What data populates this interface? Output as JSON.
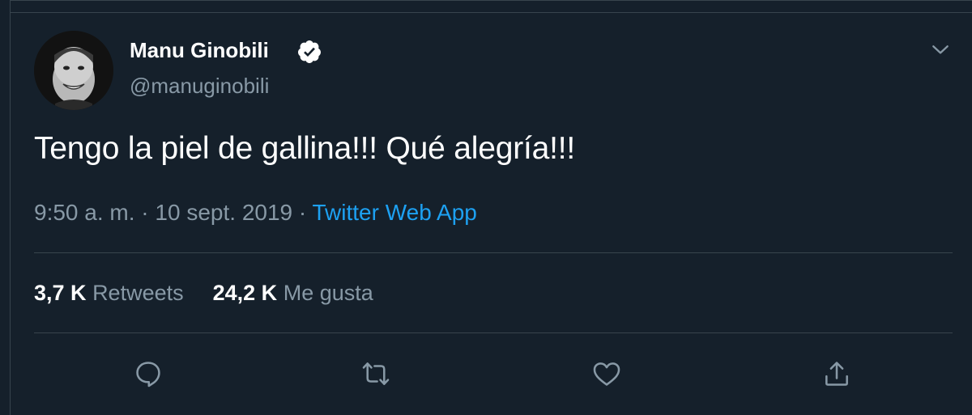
{
  "tweet": {
    "author_name": "Manu Ginobili",
    "handle": "@manuginobili",
    "text": "Tengo la piel de gallina!!! Qué alegría!!!",
    "time": "9:50 a. m.",
    "separator": "·",
    "date": "10 sept. 2019",
    "source": "Twitter Web App"
  },
  "stats": {
    "retweets_count": "3,7 K",
    "retweets_label": "Retweets",
    "likes_count": "24,2 K",
    "likes_label": "Me gusta"
  },
  "icons": {
    "verified": "verified-badge-icon",
    "caret": "chevron-down-icon",
    "reply": "reply-icon",
    "retweet": "retweet-icon",
    "like": "heart-icon",
    "share": "share-icon"
  },
  "colors": {
    "background": "#15202b",
    "border": "#38444d",
    "secondary_text": "#8899a6",
    "link": "#1da1f2"
  }
}
